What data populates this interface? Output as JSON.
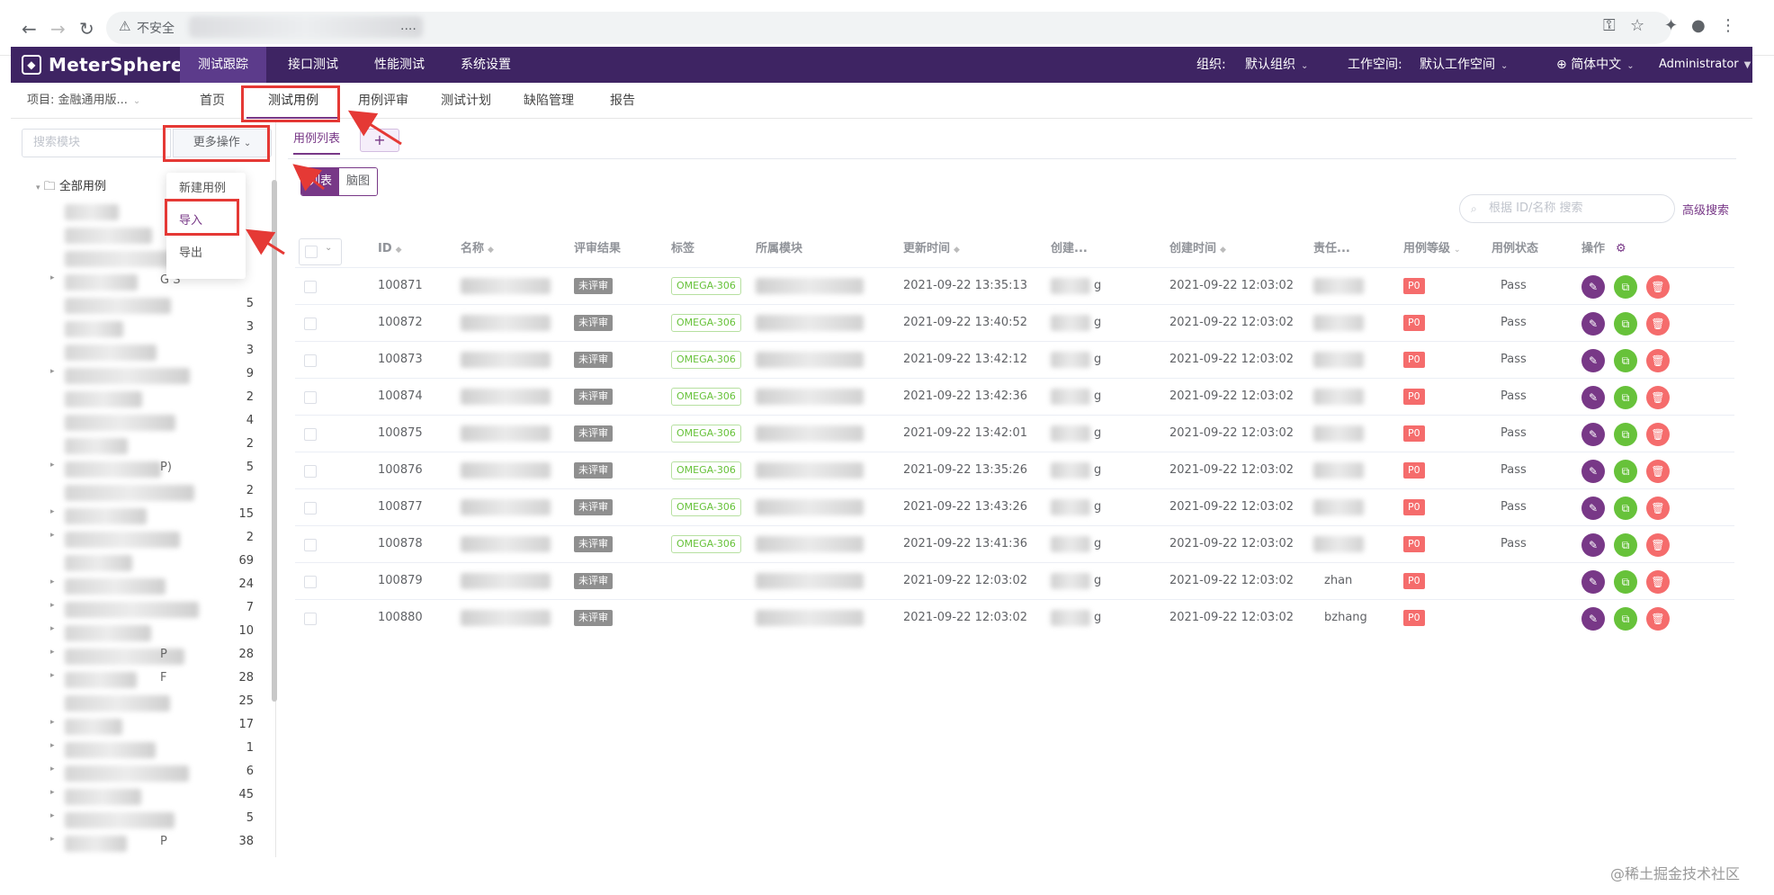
{
  "browser": {
    "url_warning": "不安全",
    "url_suffix": "...."
  },
  "header": {
    "logo": "MeterSphere",
    "menus": [
      "测试跟踪",
      "接口测试",
      "性能测试",
      "系统设置"
    ],
    "org_label": "组织:",
    "org_value": "默认组织",
    "ws_label": "工作空间:",
    "ws_value": "默认工作空间",
    "lang": "简体中文",
    "user": "Administrator"
  },
  "subnav": {
    "project": "项目: 金融通用版...",
    "items": [
      "首页",
      "测试用例",
      "用例评审",
      "测试计划",
      "缺陷管理",
      "报告"
    ]
  },
  "left": {
    "search_placeholder": "搜索模块",
    "more_ops": "更多操作",
    "dropdown": [
      "新建用例",
      "导入",
      "导出"
    ],
    "root": "全部用例",
    "counts": [
      "",
      "",
      "",
      "",
      "5",
      "3",
      "3",
      "9",
      "2",
      "4",
      "2",
      "5",
      "2",
      "15",
      "2",
      "69",
      "24",
      "7",
      "10",
      "28",
      "28",
      "25",
      "17",
      "1",
      "6",
      "45",
      "5",
      "38"
    ],
    "partial": [
      "G  S",
      "P)",
      "P",
      "F",
      "P"
    ]
  },
  "main": {
    "tab_label": "用例列表",
    "tab_add": "+",
    "view_list": "列表",
    "view_mind": "脑图",
    "search_placeholder": "根据 ID/名称 搜索",
    "advanced": "高级搜索",
    "columns": [
      "ID",
      "名称",
      "评审结果",
      "标签",
      "所属模块",
      "更新时间",
      "创建...",
      "创建时间",
      "责任...",
      "用例等级",
      "用例状态",
      "操作"
    ],
    "rows": [
      {
        "id": "100871",
        "review": "未评审",
        "tag": "OMEGA-306",
        "updated": "2021-09-22 13:35:13",
        "created": "2021-09-22 12:03:02",
        "level": "P0",
        "status": "Pass",
        "owner": ""
      },
      {
        "id": "100872",
        "review": "未评审",
        "tag": "OMEGA-306",
        "updated": "2021-09-22 13:40:52",
        "created": "2021-09-22 12:03:02",
        "level": "P0",
        "status": "Pass",
        "owner": ""
      },
      {
        "id": "100873",
        "review": "未评审",
        "tag": "OMEGA-306",
        "updated": "2021-09-22 13:42:12",
        "created": "2021-09-22 12:03:02",
        "level": "P0",
        "status": "Pass",
        "owner": ""
      },
      {
        "id": "100874",
        "review": "未评审",
        "tag": "OMEGA-306",
        "updated": "2021-09-22 13:42:36",
        "created": "2021-09-22 12:03:02",
        "level": "P0",
        "status": "Pass",
        "owner": ""
      },
      {
        "id": "100875",
        "review": "未评审",
        "tag": "OMEGA-306",
        "updated": "2021-09-22 13:42:01",
        "created": "2021-09-22 12:03:02",
        "level": "P0",
        "status": "Pass",
        "owner": ""
      },
      {
        "id": "100876",
        "review": "未评审",
        "tag": "OMEGA-306",
        "updated": "2021-09-22 13:35:26",
        "created": "2021-09-22 12:03:02",
        "level": "P0",
        "status": "Pass",
        "owner": ""
      },
      {
        "id": "100877",
        "review": "未评审",
        "tag": "OMEGA-306",
        "updated": "2021-09-22 13:43:26",
        "created": "2021-09-22 12:03:02",
        "level": "P0",
        "status": "Pass",
        "owner": ""
      },
      {
        "id": "100878",
        "review": "未评审",
        "tag": "OMEGA-306",
        "updated": "2021-09-22 13:41:36",
        "created": "2021-09-22 12:03:02",
        "level": "P0",
        "status": "Pass",
        "owner": ""
      },
      {
        "id": "100879",
        "review": "未评审",
        "tag": "",
        "updated": "2021-09-22 12:03:02",
        "created": "2021-09-22 12:03:02",
        "level": "P0",
        "status": "",
        "owner": "zhan"
      },
      {
        "id": "100880",
        "review": "未评审",
        "tag": "",
        "updated": "2021-09-22 12:03:02",
        "created": "2021-09-22 12:03:02",
        "level": "P0",
        "status": "",
        "owner": "bzhang"
      }
    ],
    "creator_suffix": "g"
  },
  "watermark": "@稀土掘金技术社区",
  "colors": {
    "brand": "#3e2463",
    "accent": "#783887",
    "annotation": "#e53935"
  }
}
